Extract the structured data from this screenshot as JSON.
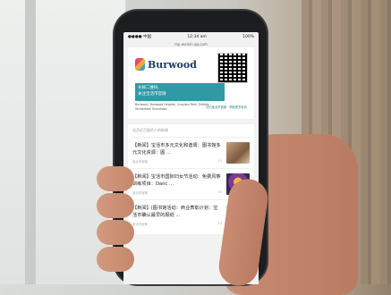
{
  "status": {
    "left": "●●●● 中国 ",
    "time": "12:34 am",
    "right": "100%"
  },
  "url": "mp.weixin.qq.com",
  "banner": {
    "brand": "Burwood",
    "teal_line1": "长按二维码,",
    "teal_line2": "关注宝活市官微",
    "address": "Burwood, Burwood Heights, Croydon Park, Enfield, Strathfield, Bunnhoat",
    "link": "访问宝活市官微 · 获取更多资讯"
  },
  "feed": {
    "section": "宝活近月版的人的新闻",
    "items": [
      {
        "title": "【新闻】宝活市多元文化和谐周：图书馆多元文化资源：图 ...",
        "source": "宝活市官微",
        "count": "15"
      },
      {
        "title": "【新闻】宝活市国际妇女节活动：免费风筝训练项目：Danc ...",
        "source": "宝活市官微",
        "count": "15"
      },
      {
        "title": "【新闻】(图书馆活动：商业表彰计划：宝活市确认最早的报纸 ...",
        "source": "宝活市官微",
        "count": "15"
      }
    ]
  },
  "colors": {
    "teal": "#2f9aa5",
    "brand_navy": "#213a6b"
  }
}
